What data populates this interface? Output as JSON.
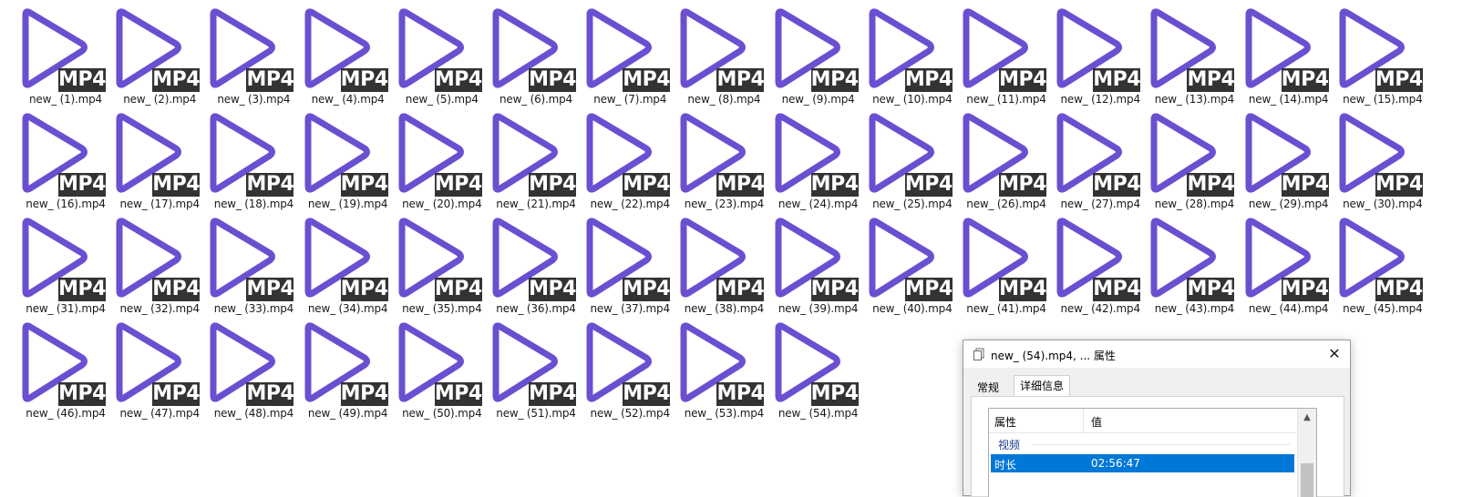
{
  "icon_badge_text": "MP4",
  "colors": {
    "play_icon": "#6a4fd1",
    "badge_bg": "#333333",
    "selection": "#0078d7"
  },
  "files": [
    "new_ (1).mp4",
    "new_ (2).mp4",
    "new_ (3).mp4",
    "new_ (4).mp4",
    "new_ (5).mp4",
    "new_ (6).mp4",
    "new_ (7).mp4",
    "new_ (8).mp4",
    "new_ (9).mp4",
    "new_ (10).mp4",
    "new_ (11).mp4",
    "new_ (12).mp4",
    "new_ (13).mp4",
    "new_ (14).mp4",
    "new_ (15).mp4",
    "new_ (16).mp4",
    "new_ (17).mp4",
    "new_ (18).mp4",
    "new_ (19).mp4",
    "new_ (20).mp4",
    "new_ (21).mp4",
    "new_ (22).mp4",
    "new_ (23).mp4",
    "new_ (24).mp4",
    "new_ (25).mp4",
    "new_ (26).mp4",
    "new_ (27).mp4",
    "new_ (28).mp4",
    "new_ (29).mp4",
    "new_ (30).mp4",
    "new_ (31).mp4",
    "new_ (32).mp4",
    "new_ (33).mp4",
    "new_ (34).mp4",
    "new_ (35).mp4",
    "new_ (36).mp4",
    "new_ (37).mp4",
    "new_ (38).mp4",
    "new_ (39).mp4",
    "new_ (40).mp4",
    "new_ (41).mp4",
    "new_ (42).mp4",
    "new_ (43).mp4",
    "new_ (44).mp4",
    "new_ (45).mp4",
    "new_ (46).mp4",
    "new_ (47).mp4",
    "new_ (48).mp4",
    "new_ (49).mp4",
    "new_ (50).mp4",
    "new_ (51).mp4",
    "new_ (52).mp4",
    "new_ (53).mp4",
    "new_ (54).mp4"
  ],
  "dialog": {
    "title": "new_ (54).mp4, ... 属性",
    "close_glyph": "✕",
    "tabs": {
      "general": "常规",
      "details": "详细信息"
    },
    "table": {
      "header_name": "属性",
      "header_value": "值",
      "group_video": "视频",
      "rows": [
        {
          "name": "时长",
          "value": "02:56:47"
        }
      ]
    },
    "scroll_up_glyph": "▲"
  }
}
